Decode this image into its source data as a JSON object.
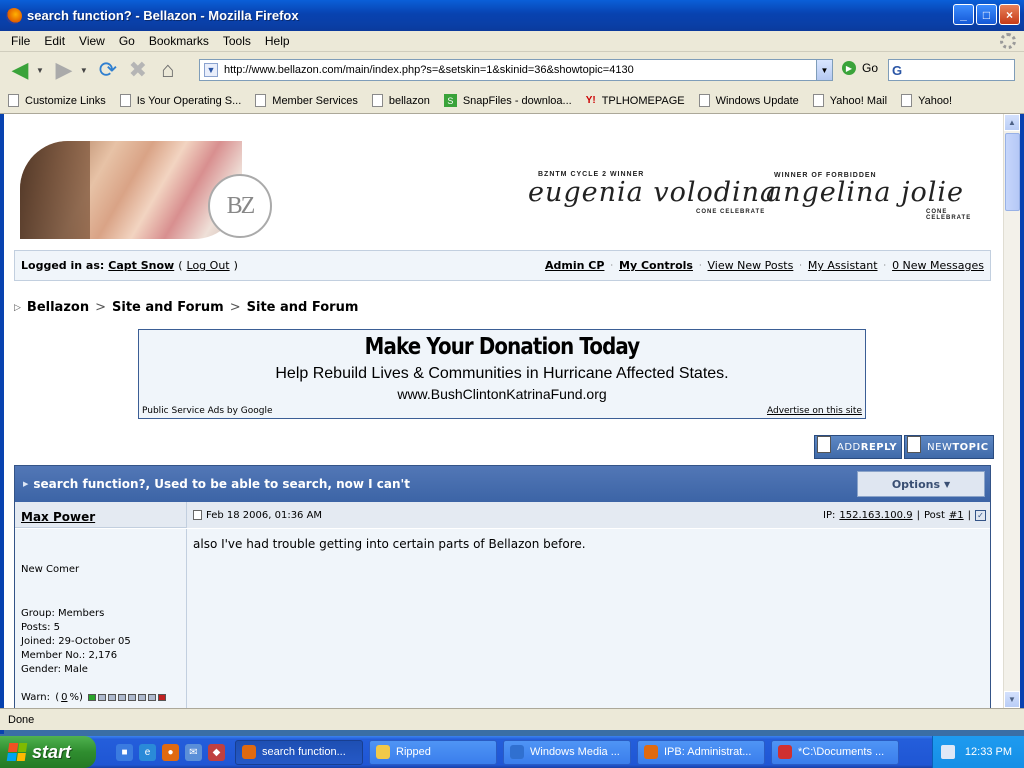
{
  "window": {
    "title": "search function? - Bellazon - Mozilla Firefox",
    "buttons": {
      "minimize": "_",
      "maximize": "□",
      "close": "×"
    }
  },
  "menubar": {
    "items": [
      "File",
      "Edit",
      "View",
      "Go",
      "Bookmarks",
      "Tools",
      "Help"
    ]
  },
  "navbar": {
    "url": "http://www.bellazon.com/main/index.php?s=&setskin=1&skinid=36&showtopic=4130",
    "go_label": "Go",
    "search_engine_glyph": "G"
  },
  "bookmarks": [
    {
      "label": "Customize Links",
      "icon": "page-icon"
    },
    {
      "label": "Is Your Operating S...",
      "icon": "page-icon"
    },
    {
      "label": "Member Services",
      "icon": "page-icon"
    },
    {
      "label": "bellazon",
      "icon": "page-icon"
    },
    {
      "label": "SnapFiles - downloa...",
      "icon": "snapfiles-icon"
    },
    {
      "label": "TPLHOMEPAGE",
      "icon": "yahoo-icon"
    },
    {
      "label": "Windows Update",
      "icon": "page-icon"
    },
    {
      "label": "Yahoo! Mail",
      "icon": "page-icon"
    },
    {
      "label": "Yahoo!",
      "icon": "page-icon"
    }
  ],
  "banner": {
    "logo_letters": "BZ",
    "sig1_small": "BZNTM CYCLE 2 WINNER",
    "sig1_name": "eugenia volodina",
    "sig1_sub": "CONE CELEBRATE",
    "sig2_small": "WINNER OF FORBIDDEN",
    "sig2_name": "angelina jolie",
    "sig2_sub": "CONE CELEBRATE"
  },
  "userbar": {
    "logged_in_label": "Logged in as:",
    "username": "Capt Snow",
    "logout": "Log Out",
    "links": [
      "Admin CP",
      "My Controls",
      "View New Posts",
      "My Assistant",
      "0 New Messages"
    ]
  },
  "breadcrumb": [
    "Bellazon",
    "Site and Forum",
    "Site and Forum"
  ],
  "ad": {
    "headline": "Make Your Donation Today",
    "subline": "Help Rebuild Lives & Communities in Hurricane Affected States.",
    "url": "www.BushClintonKatrinaFund.org",
    "left_note": "Public Service Ads by Google",
    "right_note": "Advertise on this site"
  },
  "actions": {
    "add_prefix": "ADD",
    "add_bold": "REPLY",
    "new_prefix": "NEW",
    "new_bold": "TOPIC"
  },
  "topic": {
    "title": "search function?, Used to be able to search, now I can't",
    "options_label": "Options"
  },
  "post": {
    "author": "Max Power",
    "date": "Feb 18 2006, 01:36 AM",
    "ip_label": "IP:",
    "ip": "152.163.100.9",
    "post_label": "Post",
    "post_num": "#1",
    "rank": "New Comer",
    "group": "Group: Members",
    "posts": "Posts: 5",
    "joined": "Joined: 29-October 05",
    "member_no": "Member No.: 2,176",
    "gender": "Gender: Male",
    "warn_label": "Warn:",
    "warn_value": "0",
    "body": "also I've had trouble getting into certain parts of Bellazon before."
  },
  "status": {
    "text": "Done"
  },
  "taskbar": {
    "start": "start",
    "windows": [
      {
        "label": "search function...",
        "active": true,
        "color": "#e06a10"
      },
      {
        "label": "Ripped",
        "active": false,
        "color": "#f1c94a"
      },
      {
        "label": "Windows Media ...",
        "active": false,
        "color": "#3070d0"
      },
      {
        "label": "IPB: Administrat...",
        "active": false,
        "color": "#e06a10"
      },
      {
        "label": "*C:\\Documents ...",
        "active": false,
        "color": "#d03030"
      }
    ],
    "clock": "12:33 PM"
  }
}
